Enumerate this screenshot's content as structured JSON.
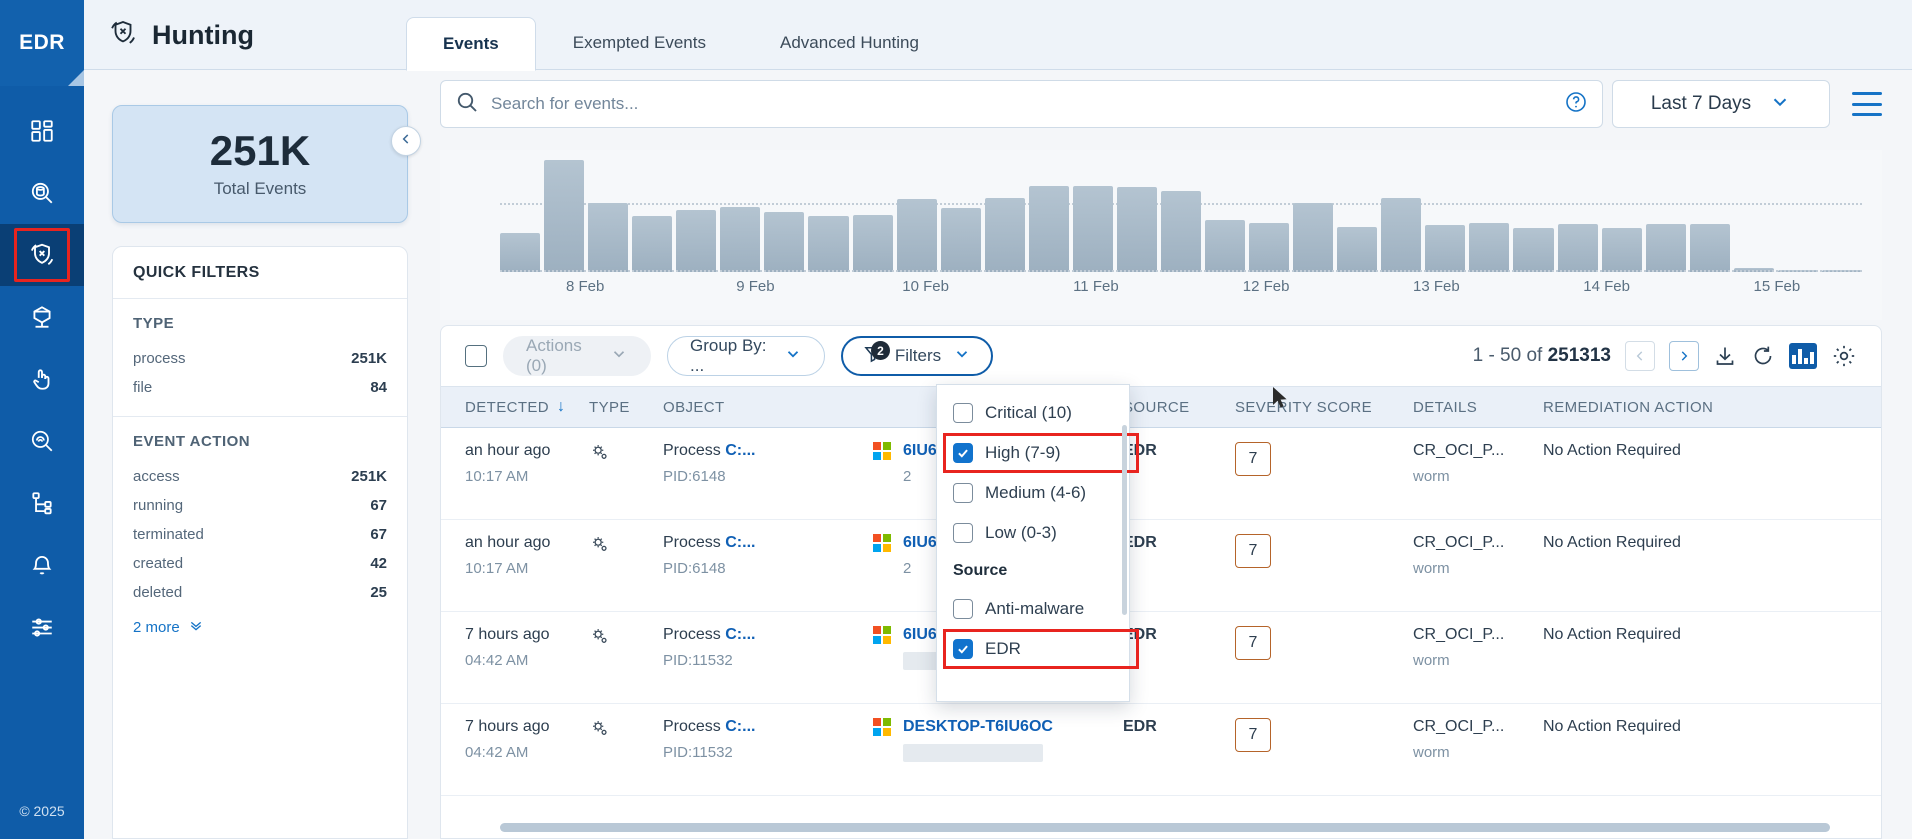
{
  "brand": {
    "label": "EDR",
    "copyright": "© 2025"
  },
  "nav": {
    "items": [
      {
        "icon": "dashboard-icon",
        "name": "dashboard",
        "active": false,
        "highlighted": false
      },
      {
        "icon": "inventory-search-icon",
        "name": "investigate",
        "active": false,
        "highlighted": false
      },
      {
        "icon": "hunting-shield-icon",
        "name": "hunting",
        "active": true,
        "highlighted": true
      },
      {
        "icon": "package-icon",
        "name": "assets",
        "active": false,
        "highlighted": false
      },
      {
        "icon": "hand-click-icon",
        "name": "response",
        "active": false,
        "highlighted": false
      },
      {
        "icon": "fingerprint-search-icon",
        "name": "forensics",
        "active": false,
        "highlighted": false
      },
      {
        "icon": "sitemap-icon",
        "name": "topology",
        "active": false,
        "highlighted": false
      },
      {
        "icon": "bell-icon",
        "name": "alerts",
        "active": false,
        "highlighted": false
      },
      {
        "icon": "sliders-icon",
        "name": "settings",
        "active": false,
        "highlighted": false
      }
    ]
  },
  "header": {
    "title": "Hunting",
    "title_icon": "hunting-shield-icon",
    "tabs": [
      {
        "label": "Events",
        "active": true
      },
      {
        "label": "Exempted Events",
        "active": false
      },
      {
        "label": "Advanced Hunting",
        "active": false
      }
    ]
  },
  "total_card": {
    "value": "251K",
    "label": "Total Events"
  },
  "quick_filters": {
    "heading": "QUICK FILTERS",
    "sections": [
      {
        "title": "TYPE",
        "rows": [
          {
            "label": "process",
            "count": "251K"
          },
          {
            "label": "file",
            "count": "84"
          }
        ]
      },
      {
        "title": "EVENT ACTION",
        "rows": [
          {
            "label": "access",
            "count": "251K"
          },
          {
            "label": "running",
            "count": "67"
          },
          {
            "label": "terminated",
            "count": "67"
          },
          {
            "label": "created",
            "count": "42"
          },
          {
            "label": "deleted",
            "count": "25"
          }
        ],
        "more_label": "2 more"
      }
    ]
  },
  "search": {
    "placeholder": "Search for events...",
    "value": "",
    "icon": "search-icon",
    "help_icon": "question-circle-icon"
  },
  "date_range": {
    "value": "Last 7 Days",
    "icon": "chevron-down-icon"
  },
  "menu_icon": "hamburger-menu-icon",
  "toolbar": {
    "select_all_checkbox": "select-all",
    "actions_label": "Actions (0)",
    "group_by_label": "Group By: ...",
    "filters_label": "Filters",
    "filters_badge": "2",
    "page_range": "1 - 50 of ",
    "page_total": "251313",
    "prev_icon": "chevron-left-icon",
    "next_icon": "chevron-right-icon",
    "download_icon": "download-icon",
    "refresh_icon": "refresh-icon",
    "chart_icon": "bar-chart-icon",
    "settings_icon": "gear-icon"
  },
  "filters_dropdown": {
    "items": [
      {
        "label": "Critical (10)",
        "checked": false,
        "highlighted": false,
        "type": "checkbox"
      },
      {
        "label": "High (7-9)",
        "checked": true,
        "highlighted": true,
        "type": "checkbox"
      },
      {
        "label": "Medium (4-6)",
        "checked": false,
        "highlighted": false,
        "type": "checkbox"
      },
      {
        "label": "Low (0-3)",
        "checked": false,
        "highlighted": false,
        "type": "checkbox"
      },
      {
        "label": "Source",
        "type": "group"
      },
      {
        "label": "Anti-malware",
        "checked": false,
        "highlighted": false,
        "type": "checkbox"
      },
      {
        "label": "EDR",
        "checked": true,
        "highlighted": true,
        "type": "checkbox"
      }
    ]
  },
  "table": {
    "columns": [
      {
        "label": "DETECTED",
        "sort": "↓"
      },
      {
        "label": "TYPE"
      },
      {
        "label": "OBJECT"
      },
      {
        "label": ""
      },
      {
        "label": "SOURCE"
      },
      {
        "label": "SEVERITY SCORE"
      },
      {
        "label": "DETAILS"
      },
      {
        "label": "REMEDIATION ACTION"
      }
    ],
    "rows": [
      {
        "detected": "an hour ago",
        "time": "10:17 AM",
        "type_icon": "process-gear-icon",
        "object": "Process ",
        "object_link": "C:...",
        "pid": "PID:6148",
        "host": "6IU6OC",
        "host_sub": "2",
        "source": "EDR",
        "severity": "7",
        "details": "CR_OCI_P...",
        "details_sub": "worm",
        "remediation": "No Action Required"
      },
      {
        "detected": "an hour ago",
        "time": "10:17 AM",
        "type_icon": "process-gear-icon",
        "object": "Process ",
        "object_link": "C:...",
        "pid": "PID:6148",
        "host": "6IU6OC",
        "host_sub": "2",
        "source": "EDR",
        "severity": "7",
        "details": "CR_OCI_P...",
        "details_sub": "worm",
        "remediation": "No Action Required"
      },
      {
        "detected": "7 hours ago",
        "time": "04:42 AM",
        "type_icon": "process-gear-icon",
        "object": "Process ",
        "object_link": "C:...",
        "pid": "PID:11532",
        "host": "6IU6OC",
        "host_sub": "",
        "source": "EDR",
        "severity": "7",
        "details": "CR_OCI_P...",
        "details_sub": "worm",
        "remediation": "No Action Required"
      },
      {
        "detected": "7 hours ago",
        "time": "04:42 AM",
        "type_icon": "process-gear-icon",
        "object": "Process ",
        "object_link": "C:...",
        "pid": "PID:11532",
        "host": "DESKTOP-T6IU6OC",
        "host_sub": "",
        "source": "EDR",
        "severity": "7",
        "details": "CR_OCI_P...",
        "details_sub": "worm",
        "remediation": "No Action Required"
      }
    ]
  },
  "chart_data": {
    "type": "bar",
    "title": "",
    "xlabel": "",
    "ylabel": "",
    "grid": false,
    "legend": "none",
    "tick_labels": [
      "8 Feb",
      "9 Feb",
      "10 Feb",
      "11 Feb",
      "12 Feb",
      "13 Feb",
      "14 Feb",
      "15 Feb"
    ],
    "categories": [
      "8 Feb 00",
      "8 Feb 06",
      "8 Feb 12",
      "8 Feb 18",
      "9 Feb 00",
      "9 Feb 06",
      "9 Feb 12",
      "9 Feb 18",
      "10 Feb 00",
      "10 Feb 06",
      "10 Feb 12",
      "10 Feb 18",
      "11 Feb 00",
      "11 Feb 06",
      "11 Feb 12",
      "11 Feb 18",
      "12 Feb 00",
      "12 Feb 06",
      "12 Feb 12",
      "12 Feb 18",
      "13 Feb 00",
      "13 Feb 06",
      "13 Feb 12",
      "13 Feb 18",
      "14 Feb 00",
      "14 Feb 06",
      "14 Feb 12",
      "14 Feb 18",
      "15 Feb 00",
      "15 Feb 06",
      "15 Feb 12"
    ],
    "values": [
      35,
      100,
      62,
      50,
      55,
      58,
      54,
      50,
      51,
      65,
      57,
      66,
      77,
      77,
      76,
      72,
      46,
      44,
      62,
      40,
      66,
      42,
      44,
      39,
      43,
      39,
      43,
      43,
      4,
      2,
      2
    ],
    "ylim": [
      0,
      100
    ],
    "threshold_line": 62
  }
}
